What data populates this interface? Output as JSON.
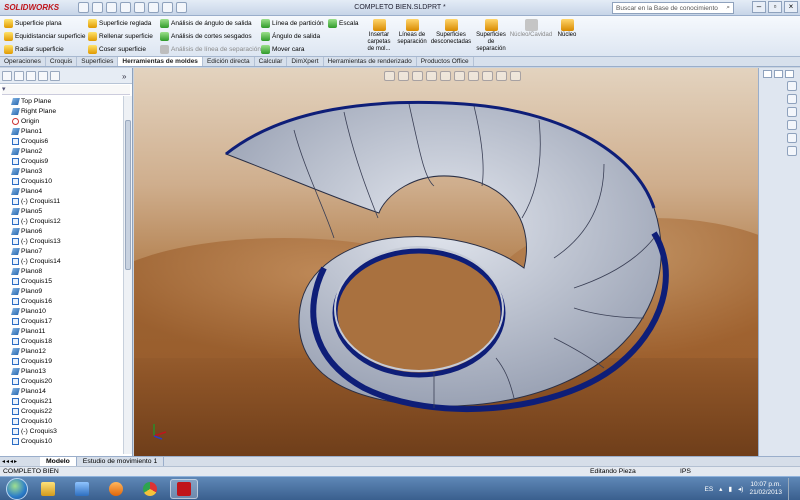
{
  "app": {
    "logo": "SOLIDWORKS",
    "document_title": "COMPLETO BIEN.SLDPRT *",
    "search_placeholder": "Buscar en la Base de conocimiento"
  },
  "ribbon": {
    "col1": [
      {
        "label": "Superficie plana",
        "icon": "plane-surface-icon"
      },
      {
        "label": "Equidistanciar superficie",
        "icon": "offset-surface-icon"
      },
      {
        "label": "Radiar superficie",
        "icon": "radiate-surface-icon"
      }
    ],
    "col2": [
      {
        "label": "Superficie reglada",
        "icon": "ruled-surface-icon"
      },
      {
        "label": "Rellenar superficie",
        "icon": "fill-surface-icon"
      },
      {
        "label": "Coser superficie",
        "icon": "knit-surface-icon"
      }
    ],
    "col3": [
      {
        "label": "Análisis de ángulo de salida",
        "icon": "draft-analysis-icon"
      },
      {
        "label": "Análisis de cortes sesgados",
        "icon": "undercut-analysis-icon"
      },
      {
        "label": "Análisis de línea de separación",
        "icon": "parting-line-analysis-icon",
        "disabled": true
      }
    ],
    "col4": [
      {
        "label": "Línea de partición",
        "icon": "split-line-icon"
      },
      {
        "label": "Ángulo de salida",
        "icon": "draft-icon"
      },
      {
        "label": "Mover cara",
        "icon": "move-face-icon"
      }
    ],
    "col5": [
      {
        "label": "Escala",
        "icon": "scale-icon"
      }
    ],
    "big": [
      {
        "label": "Insertar carpetas de mol...",
        "icon": "insert-mold-folders-icon"
      },
      {
        "label": "Líneas de separación",
        "icon": "parting-lines-icon"
      },
      {
        "label": "Superficies desconectadas",
        "icon": "shut-off-surfaces-icon"
      },
      {
        "label": "Superficies de separación",
        "icon": "parting-surfaces-icon"
      },
      {
        "label": "Núcleo/Cavidad",
        "icon": "core-cavity-icon",
        "disabled": true
      },
      {
        "label": "Núcleo",
        "icon": "core-icon"
      }
    ]
  },
  "tabs": [
    "Operaciones",
    "Croquis",
    "Superficies",
    "Herramientas de moldes",
    "Edición directa",
    "Calcular",
    "DimXpert",
    "Herramientas de renderizado",
    "Productos Office"
  ],
  "active_tab": "Herramientas de moldes",
  "tree": [
    {
      "label": "Top Plane",
      "type": "plane"
    },
    {
      "label": "Right Plane",
      "type": "plane"
    },
    {
      "label": "Origin",
      "type": "origin"
    },
    {
      "label": "Plano1",
      "type": "plane"
    },
    {
      "label": "Croquis6",
      "type": "sketch"
    },
    {
      "label": "Plano2",
      "type": "plane"
    },
    {
      "label": "Croquis9",
      "type": "sketch"
    },
    {
      "label": "Plano3",
      "type": "plane"
    },
    {
      "label": "Croquis10",
      "type": "sketch"
    },
    {
      "label": "Plano4",
      "type": "plane"
    },
    {
      "label": "(-) Croquis11",
      "type": "sketch"
    },
    {
      "label": "Plano5",
      "type": "plane"
    },
    {
      "label": "(-) Croquis12",
      "type": "sketch"
    },
    {
      "label": "Plano6",
      "type": "plane"
    },
    {
      "label": "(-) Croquis13",
      "type": "sketch"
    },
    {
      "label": "Plano7",
      "type": "plane"
    },
    {
      "label": "(-) Croquis14",
      "type": "sketch"
    },
    {
      "label": "Plano8",
      "type": "plane"
    },
    {
      "label": "Croquis15",
      "type": "sketch"
    },
    {
      "label": "Plano9",
      "type": "plane"
    },
    {
      "label": "Croquis16",
      "type": "sketch"
    },
    {
      "label": "Plano10",
      "type": "plane"
    },
    {
      "label": "Croquis17",
      "type": "sketch"
    },
    {
      "label": "Plano11",
      "type": "plane"
    },
    {
      "label": "Croquis18",
      "type": "sketch"
    },
    {
      "label": "Plano12",
      "type": "plane"
    },
    {
      "label": "Croquis19",
      "type": "sketch"
    },
    {
      "label": "Plano13",
      "type": "plane"
    },
    {
      "label": "Croquis20",
      "type": "sketch"
    },
    {
      "label": "Plano14",
      "type": "plane"
    },
    {
      "label": "Croquis21",
      "type": "sketch"
    },
    {
      "label": "Croquis22",
      "type": "sketch"
    },
    {
      "label": "Croquis10",
      "type": "sketch"
    },
    {
      "label": "(-) Croquis3",
      "type": "sketch"
    },
    {
      "label": "Croquis10",
      "type": "sketch"
    }
  ],
  "bottom_tabs": [
    "Modelo",
    "Estudio de movimiento 1"
  ],
  "status": {
    "left": "COMPLETO BIEN",
    "mode": "Editando Pieza",
    "units": "IPS"
  },
  "tray": {
    "language": "ES",
    "time": "10:07 p.m.",
    "date": "21/02/2013"
  },
  "colors": {
    "model_edge": "#0e1e78",
    "model_face": "#c6cbd6",
    "accent": "#c0141a"
  }
}
